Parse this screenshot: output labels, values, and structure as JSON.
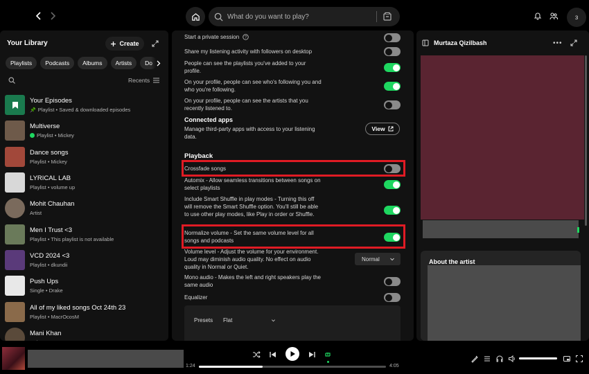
{
  "header": {
    "search_placeholder": "What do you want to play?",
    "avatar_initial": "з"
  },
  "library": {
    "title": "Your Library",
    "create_label": "Create",
    "filters": [
      "Playlists",
      "Podcasts",
      "Albums",
      "Artists",
      "Do"
    ],
    "sort_label": "Recents",
    "items": [
      {
        "title": "Your Episodes",
        "subtitle": "Playlist • Saved & downloaded episodes",
        "thumb": "#1a7a4e",
        "icon": "pin"
      },
      {
        "title": "Multiverse",
        "subtitle": "Playlist • Mickey",
        "thumb": "#6e5a4a",
        "icon": "download"
      },
      {
        "title": "Dance songs",
        "subtitle": "Playlist • Mickey",
        "thumb": "#a2483a"
      },
      {
        "title": "LYRICAL LAB",
        "subtitle": "Playlist • volume up",
        "thumb": "#d8d8d8"
      },
      {
        "title": "Mohit Chauhan",
        "subtitle": "Artist",
        "thumb": "#7a6a5c",
        "round": true
      },
      {
        "title": "Men I Trust <3",
        "subtitle": "Playlist • This playlist is not available",
        "thumb": "#6a7a5a"
      },
      {
        "title": "VCD 2024 <3",
        "subtitle": "Playlist • dkundii",
        "thumb": "#5a3a7a"
      },
      {
        "title": "Push Ups",
        "subtitle": "Single • Drake",
        "thumb": "#e8e8e8"
      },
      {
        "title": "All of my liked songs Oct 24th 23",
        "subtitle": "Playlist • MacrOcosM",
        "thumb": "#8a6a4a"
      },
      {
        "title": "Mani Khan",
        "subtitle": "Artist",
        "thumb": "#5a4a3a",
        "round": true
      }
    ]
  },
  "settings": {
    "private_session": "Start a private session",
    "share_activity": "Share my listening activity with followers on desktop",
    "see_playlists": "People can see the playlists you've added to your profile.",
    "see_following": "On your profile, people can see who's following you and who you're following.",
    "see_artists": "On your profile, people can see the artists that you recently listened to.",
    "connected_apps_title": "Connected apps",
    "connected_apps_desc": "Manage third-party apps with access to your listening data.",
    "view_label": "View",
    "playback_title": "Playback",
    "crossfade": "Crossfade songs",
    "automix": "Automix - Allow seamless transitions between songs on select playlists",
    "smart_shuffle": "Include Smart Shuffle in play modes - Turning this off will remove the Smart Shuffle option. You'll still be able to use other play modes, like Play in order or Shuffle.",
    "normalize": "Normalize volume - Set the same volume level for all songs and podcasts",
    "volume_level": "Volume level - Adjust the volume for your environment. Loud may diminish audio quality. No effect on audio quality in Normal or Quiet.",
    "volume_level_value": "Normal",
    "mono_audio": "Mono audio - Makes the left and right speakers play the same audio",
    "equalizer": "Equalizer",
    "presets_label": "Presets",
    "presets_value": "Flat"
  },
  "right_panel": {
    "artist_name": "Murtaza Qizilbash",
    "about_label": "About the artist",
    "art_color": "#5a2431"
  },
  "player": {
    "elapsed": "1:24",
    "duration": "4:05",
    "progress": 0.34,
    "volume": 1.0
  },
  "colors": {
    "accent": "#1ed760",
    "highlight": "#e01b24",
    "panel": "#121212"
  }
}
